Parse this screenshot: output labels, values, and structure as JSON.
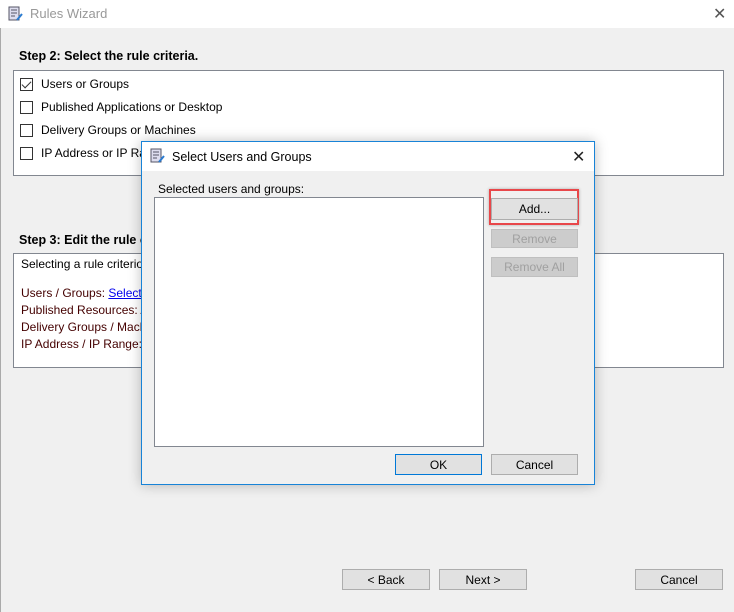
{
  "window": {
    "title": "Rules Wizard",
    "close": "✕"
  },
  "step2": {
    "heading": "Step 2: Select the rule criteria.",
    "criteria": [
      {
        "label": "Users or Groups",
        "checked": true
      },
      {
        "label": "Published Applications or Desktop",
        "checked": false
      },
      {
        "label": "Delivery Groups or Machines",
        "checked": false
      },
      {
        "label": "IP Address or IP Range",
        "checked": false
      }
    ]
  },
  "step3": {
    "heading": "Step 3: Edit the rule criteria",
    "intro": "Selecting a rule criterion",
    "users_label": "Users / Groups: ",
    "users_link": "Select Users",
    "published": "Published Resources: All",
    "delivery": "Delivery Groups / Machines: All",
    "ip": "IP Address / IP Range: All"
  },
  "nav": {
    "back": "< Back",
    "next": "Next >",
    "cancel": "Cancel"
  },
  "dialog": {
    "title": "Select Users and Groups",
    "close": "✕",
    "list_label": "Selected users and groups:",
    "add": "Add...",
    "remove": "Remove",
    "remove_all": "Remove All",
    "ok": "OK",
    "cancel": "Cancel",
    "highlight_color": "#e8474a"
  }
}
